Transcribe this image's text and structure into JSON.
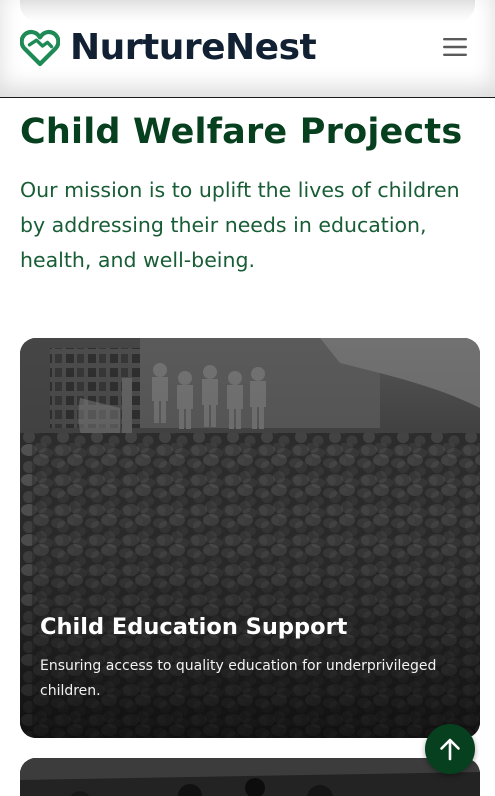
{
  "header": {
    "brand_name": "NurtureNest",
    "logo_icon": "heart-hands-icon",
    "menu_icon": "hamburger-menu-icon"
  },
  "main": {
    "title": "Child Welfare Projects",
    "intro": "Our mission is to uplift the lives of children by addressing their needs in education, health, and well-being."
  },
  "projects": [
    {
      "title": "Child Education Support",
      "description": "Ensuring access to quality education for underprivileged children."
    }
  ],
  "floating_button": {
    "icon": "arrow-up-icon"
  },
  "colors": {
    "brand_green": "#07401f",
    "logo_green": "#1e8a55",
    "intro_text": "#185d35",
    "brand_text": "#112033"
  }
}
